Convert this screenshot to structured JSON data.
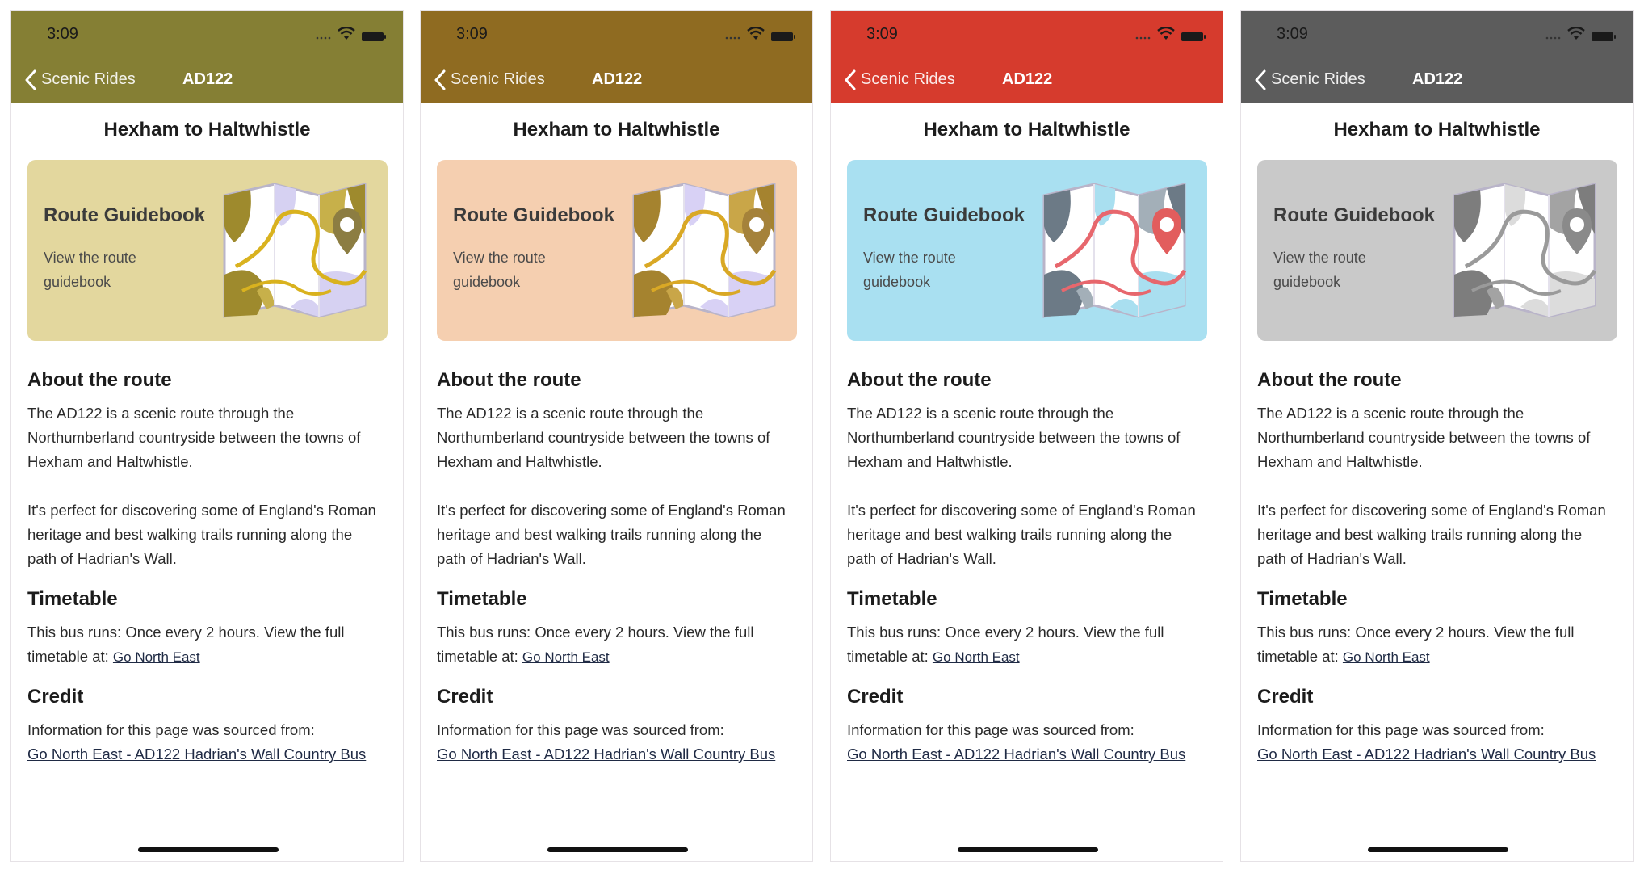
{
  "status_bar": {
    "time": "3:09"
  },
  "nav": {
    "back_label": "Scenic Rides",
    "title": "AD122"
  },
  "route_title": "Hexham to Haltwhistle",
  "guidebook": {
    "title": "Route Guidebook",
    "subtitle": "View the route guidebook"
  },
  "about": {
    "heading": "About the route",
    "para1": "The AD122 is a scenic route through the Northumberland countryside between the towns of Hexham and Haltwhistle.",
    "para2": "It's perfect for discovering some of England's Roman heritage and best walking trails running along the path of Hadrian's Wall."
  },
  "timetable": {
    "heading": "Timetable",
    "text": "This bus runs: Once every 2 hours. View the full timetable at:",
    "link": "Go North East"
  },
  "credit": {
    "heading": "Credit",
    "text": "Information for this page was sourced from:",
    "link": "Go North East - AD122 Hadrian's Wall Country Bus"
  },
  "themes": [
    {
      "nav": "#857f34",
      "card": "#e3d79e",
      "dark": "#9e8a2d",
      "mid": "#c7b04a",
      "light": "#d6d1f2",
      "route": "#d9b21f",
      "pin": "#8c7d42"
    },
    {
      "nav": "#8f6b21",
      "card": "#f5cfb0",
      "dark": "#a5832f",
      "mid": "#c9a648",
      "light": "#d8d1f5",
      "route": "#d9a825",
      "pin": "#a5823a"
    },
    {
      "nav": "#d63b2d",
      "card": "#a9e0f1",
      "dark": "#6c7a86",
      "mid": "#a3afb8",
      "light": "#a9dff0",
      "route": "#e7676d",
      "pin": "#e25d5d"
    },
    {
      "nav": "#5c5c5c",
      "card": "#c9c9c9",
      "dark": "#7d7d7d",
      "mid": "#a3a3a3",
      "light": "#dcdcdc",
      "route": "#9a9a9a",
      "pin": "#8a8a8a"
    }
  ]
}
